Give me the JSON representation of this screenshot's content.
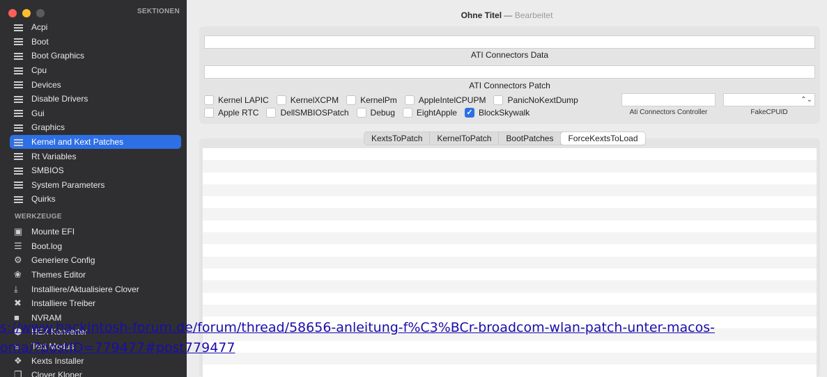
{
  "window": {
    "title": "Ohne Titel",
    "separator": "—",
    "status": "Bearbeitet"
  },
  "sidebar": {
    "sections_title": "SEKTIONEN",
    "items": [
      {
        "label": "Acpi",
        "icon": "list-icon"
      },
      {
        "label": "Boot",
        "icon": "list-icon"
      },
      {
        "label": "Boot Graphics",
        "icon": "list-icon"
      },
      {
        "label": "Cpu",
        "icon": "list-icon"
      },
      {
        "label": "Devices",
        "icon": "list-icon"
      },
      {
        "label": "Disable Drivers",
        "icon": "list-icon"
      },
      {
        "label": "Gui",
        "icon": "list-icon"
      },
      {
        "label": "Graphics",
        "icon": "list-icon"
      },
      {
        "label": "Kernel and Kext Patches",
        "icon": "list-icon",
        "active": true
      },
      {
        "label": "Rt Variables",
        "icon": "list-icon"
      },
      {
        "label": "SMBIOS",
        "icon": "list-icon"
      },
      {
        "label": "System Parameters",
        "icon": "list-icon"
      },
      {
        "label": "Quirks",
        "icon": "list-icon"
      }
    ],
    "tools_title": "WERKZEUGE",
    "tools": [
      {
        "label": "Mounte EFI",
        "icon": "disk-icon"
      },
      {
        "label": "Boot.log",
        "icon": "log-icon"
      },
      {
        "label": "Generiere Config",
        "icon": "gears-icon"
      },
      {
        "label": "Themes Editor",
        "icon": "palette-icon"
      },
      {
        "label": "Installiere/Aktualisiere Clover",
        "icon": "download-icon"
      },
      {
        "label": "Installiere Treiber",
        "icon": "wrench-icon"
      },
      {
        "label": "NVRAM",
        "icon": "chip-icon"
      },
      {
        "label": "HEX Konverter",
        "icon": "hex-icon"
      },
      {
        "label": "Text Modus",
        "icon": "text-icon"
      },
      {
        "label": "Kexts Installer",
        "icon": "puzzle-icon"
      },
      {
        "label": "Clover Kloner",
        "icon": "copy-icon"
      }
    ]
  },
  "kernel": {
    "ati_connectors_data_label": "ATI Connectors Data",
    "ati_connectors_data_value": "",
    "ati_connectors_patch_label": "ATI Connectors Patch",
    "ati_connectors_patch_value": "",
    "checkboxes_row1": [
      {
        "label": "Kernel LAPIC",
        "checked": false
      },
      {
        "label": "KernelXCPM",
        "checked": false
      },
      {
        "label": "KernelPm",
        "checked": false
      },
      {
        "label": "AppleIntelCPUPM",
        "checked": false
      },
      {
        "label": "PanicNoKextDump",
        "checked": false
      }
    ],
    "checkboxes_row2": [
      {
        "label": "Apple RTC",
        "checked": false
      },
      {
        "label": "DellSMBIOSPatch",
        "checked": false
      },
      {
        "label": "Debug",
        "checked": false
      },
      {
        "label": "EightApple",
        "checked": false
      },
      {
        "label": "BlockSkywalk",
        "checked": true
      }
    ],
    "ati_connectors_controller_label": "Ati Connectors Controller",
    "ati_connectors_controller_value": "",
    "fake_cpuid_label": "FakeCPUID",
    "fake_cpuid_value": ""
  },
  "tabs": [
    {
      "label": "KextsToPatch",
      "active": false
    },
    {
      "label": "KernelToPatch",
      "active": false
    },
    {
      "label": "BootPatches",
      "active": false
    },
    {
      "label": "ForceKextsToLoad",
      "active": true
    }
  ],
  "overlay_link": {
    "line1": "s://www.hackintosh-forum.de/forum/thread/58656-anleitung-f%C3%BCr-broadcom-wlan-patch-unter-macos-",
    "line2": "oma/?postID=779477#post779477"
  },
  "colors": {
    "accent": "#2d6fe5",
    "sidebar_bg": "#2f2f31",
    "link": "#1a0dab"
  }
}
